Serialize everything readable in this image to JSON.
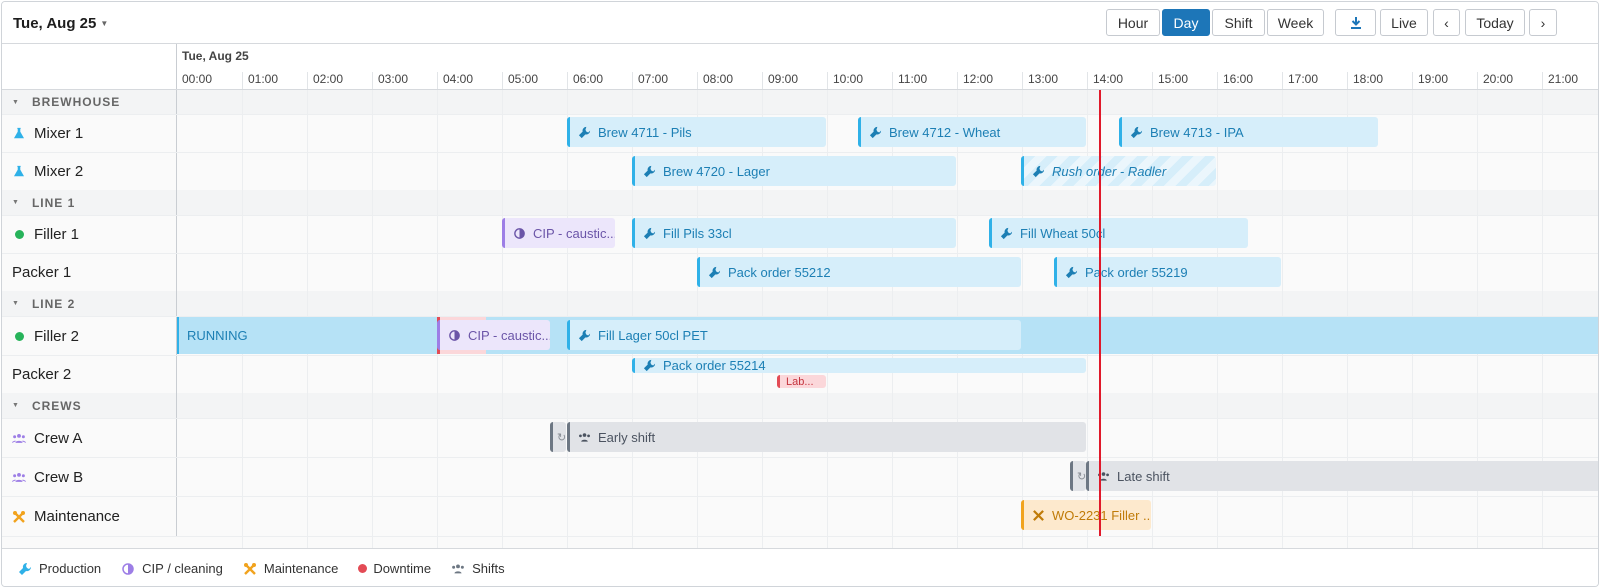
{
  "toolbar": {
    "date_title": "Tue, Aug 25",
    "views": [
      "Hour",
      "Day",
      "Shift",
      "Week"
    ],
    "active_view": "Day",
    "live_label": "Live",
    "prev_label": "‹",
    "today_label": "Today",
    "next_label": "›"
  },
  "timeline": {
    "day_label": "Tue, Aug 25",
    "hours": [
      "00:00",
      "01:00",
      "02:00",
      "03:00",
      "04:00",
      "05:00",
      "06:00",
      "07:00",
      "08:00",
      "09:00",
      "10:00",
      "11:00",
      "12:00",
      "13:00",
      "14:00",
      "15:00",
      "16:00",
      "17:00",
      "18:00",
      "19:00",
      "20:00",
      "21:00"
    ],
    "now_hour": 14.2
  },
  "groups": {
    "brewhouse": "BREWHOUSE",
    "line1": "LINE 1",
    "line2": "LINE 2",
    "crews": "CREWS"
  },
  "resources": {
    "mixer1": "Mixer 1",
    "mixer2": "Mixer 2",
    "filler1": "Filler 1",
    "packer1": "Packer 1",
    "filler2": "Filler 2",
    "packer2": "Packer 2",
    "crewA": "Crew A",
    "crewB": "Crew B",
    "maintenance": "Maintenance"
  },
  "events": {
    "brew4711": "Brew 4711 - Pils",
    "brew4712": "Brew 4712 - Wheat",
    "brew4713": "Brew 4713 - IPA",
    "brew4720": "Brew 4720 - Lager",
    "rush": "Rush order - Radler",
    "cip1": "CIP - caustic...",
    "fillPils": "Fill Pils 33cl",
    "fillWheat": "Fill Wheat 50cl",
    "pack55212": "Pack order 55212",
    "pack55219": "Pack order 55219",
    "running": "RUNNING",
    "cip2": "CIP - caustic...",
    "fillLager": "Fill Lager 50cl PET",
    "pack55214": "Pack order 55214",
    "lab": "Lab...",
    "earlyShift": "Early shift",
    "lateShift": "Late shift",
    "wo": "WO-2231 Filler ..."
  },
  "legend": {
    "production": "Production",
    "cip": "CIP / cleaning",
    "maintenance": "Maintenance",
    "downtime": "Downtime",
    "shifts": "Shifts"
  },
  "colors": {
    "accent": "#1d76b8",
    "production": "#2fb1e8",
    "cip": "#9d7ee6",
    "maintenance": "#f1a31e",
    "downtime": "#e34b55",
    "shift": "#6d7783",
    "running_status": "#27b35a",
    "now": "#e0192a"
  }
}
